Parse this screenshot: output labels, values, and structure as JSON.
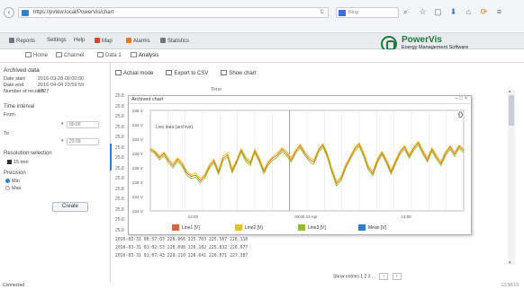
{
  "browser": {
    "url": "https://pvtew.local/PowerVis/chart",
    "reload": "C",
    "search_placeholder": "Bing",
    "icons": [
      "back-icon",
      "star-icon",
      "reading-list-icon",
      "download-icon",
      "home-icon",
      "sync-icon",
      "menu-icon"
    ]
  },
  "menu": {
    "items": [
      "Reports",
      "Settings",
      "Help",
      "Map",
      "Alarms",
      "Statistics"
    ],
    "colors": [
      "#6f7882",
      "#6f7882",
      "#6f7882",
      "#d9442c",
      "#e07a1f",
      "#6f7882"
    ]
  },
  "brand": {
    "name": "PowerVis",
    "tagline": "Energy Management Software"
  },
  "tabs": {
    "items": [
      "Home",
      "Channel",
      "Data 1",
      "Analysis"
    ]
  },
  "left_panel": {
    "title": "Archived data",
    "rows": [
      {
        "label": "Date start",
        "value": "2016-03-28 00:00:00"
      },
      {
        "label": "Date end",
        "value": "2016-04-04 23:59:59"
      },
      {
        "label": "Number of records",
        "value": "1727"
      }
    ],
    "interval_title": "Time interval",
    "from_label": "From",
    "from_value": "00:00",
    "to_label": "To",
    "to_value": "23:59",
    "resolution_title": "Resolution selection",
    "resolution_value": "15 min",
    "precision_title": "Precision",
    "precision_options": [
      "Min",
      "Max"
    ],
    "create_button": "Create"
  },
  "toolbar": {
    "items": [
      "Actual mode",
      "Export to CSV",
      "Show chart"
    ]
  },
  "table": {
    "column_header": "Time",
    "row_labels": [
      "25.8",
      "25.8",
      "25.8",
      "25.8",
      "25.8",
      "25.8",
      "25.8",
      "25.8",
      "25.8",
      "25.8",
      "25.8",
      "25.8",
      "25.8",
      "25.8"
    ],
    "rows": [
      "2016-03-31 00:57:03  228.966  225.703  225.567  226.110",
      "2016-03-31 01:02:53  228.098  226.102  225.832  226.677",
      "2016-03-31 01:07:43  229.210  226.641  226.071  227.307"
    ]
  },
  "chart_window": {
    "title": "Archived chart",
    "controls": "– □ ×",
    "value_readout": "0",
    "sub_label": "Live data (archive)"
  },
  "chart_data": {
    "type": "line",
    "x_ticks": [
      "12:00",
      "00:00 23 Apr",
      "12:00"
    ],
    "y_ticks": [
      "236 V",
      "234 V",
      "232 V",
      "230 V",
      "228 V",
      "226 V",
      "224 V",
      "222 V"
    ],
    "ylim": [
      222,
      236
    ],
    "colors": [
      "#e0641f",
      "#e6c21a",
      "#8fbf2a",
      "#2f7fd1"
    ],
    "series": [
      {
        "name": "Line1 [V]",
        "values": [
          230.6,
          230.2,
          229.4,
          230.0,
          229.0,
          228.3,
          229.2,
          228.5,
          227.3,
          226.8,
          227.0,
          226.2,
          226.9,
          228.2,
          229.0,
          227.4,
          229.3,
          229.8,
          227.6,
          228.9,
          230.5,
          229.2,
          228.6,
          230.4,
          229.1,
          227.5,
          228.7,
          229.4,
          229.8,
          230.6,
          230.0,
          229.1,
          230.3,
          231.1,
          230.0,
          229.2,
          228.8,
          230.4,
          231.2,
          229.7,
          227.6,
          225.8,
          226.5,
          228.2,
          229.4,
          230.6,
          231.3,
          229.8,
          228.0,
          227.2,
          229.0,
          230.1,
          228.9,
          227.4,
          228.8,
          230.2,
          230.9,
          229.6,
          230.7,
          231.5,
          230.2,
          229.1,
          230.6,
          229.5,
          228.6,
          230.0,
          230.9,
          229.9,
          231.0,
          230.4
        ]
      },
      {
        "name": "Line2 [V]",
        "values": [
          230.8,
          230.4,
          229.6,
          230.2,
          229.3,
          228.6,
          229.4,
          228.8,
          227.6,
          227.0,
          227.3,
          226.5,
          227.1,
          228.5,
          229.2,
          227.7,
          229.6,
          230.1,
          227.9,
          229.1,
          230.7,
          229.5,
          228.9,
          230.6,
          229.4,
          227.8,
          228.9,
          229.6,
          230.1,
          230.8,
          230.3,
          229.4,
          230.5,
          231.3,
          230.3,
          229.5,
          229.1,
          230.6,
          231.4,
          230.0,
          227.9,
          226.1,
          226.8,
          228.5,
          229.6,
          230.8,
          231.5,
          230.1,
          228.3,
          227.5,
          229.3,
          230.3,
          229.2,
          227.7,
          229.1,
          230.4,
          231.1,
          229.9,
          230.9,
          231.7,
          230.5,
          229.4,
          230.8,
          229.8,
          228.9,
          230.3,
          231.1,
          230.2,
          231.2,
          230.6
        ]
      },
      {
        "name": "Line3 [V]",
        "values": [
          230.4,
          230.0,
          229.1,
          229.7,
          228.7,
          228.0,
          228.9,
          228.2,
          227.0,
          226.5,
          226.7,
          225.9,
          226.6,
          227.9,
          228.7,
          227.1,
          229.0,
          229.5,
          227.3,
          228.6,
          230.2,
          228.9,
          228.3,
          230.1,
          228.8,
          227.2,
          228.4,
          229.1,
          229.5,
          230.3,
          229.7,
          228.8,
          230.0,
          230.8,
          229.7,
          228.9,
          228.5,
          230.1,
          230.9,
          229.4,
          227.3,
          225.5,
          226.2,
          227.9,
          229.1,
          230.3,
          231.0,
          229.5,
          227.7,
          226.9,
          228.7,
          229.8,
          228.6,
          227.1,
          228.5,
          229.9,
          230.6,
          229.3,
          230.4,
          231.2,
          229.9,
          228.8,
          230.3,
          229.2,
          228.3,
          229.7,
          230.6,
          229.6,
          230.7,
          230.1
        ]
      }
    ],
    "legend": [
      "Line1 [V]",
      "Line2 [V]",
      "Line3 [V]",
      "Mean [V]"
    ]
  },
  "pager": {
    "text": "Show entries  1  2  3 ...",
    "prev": "‹",
    "next": "›"
  },
  "status": {
    "left": "Connected",
    "right": "13:58:19"
  }
}
